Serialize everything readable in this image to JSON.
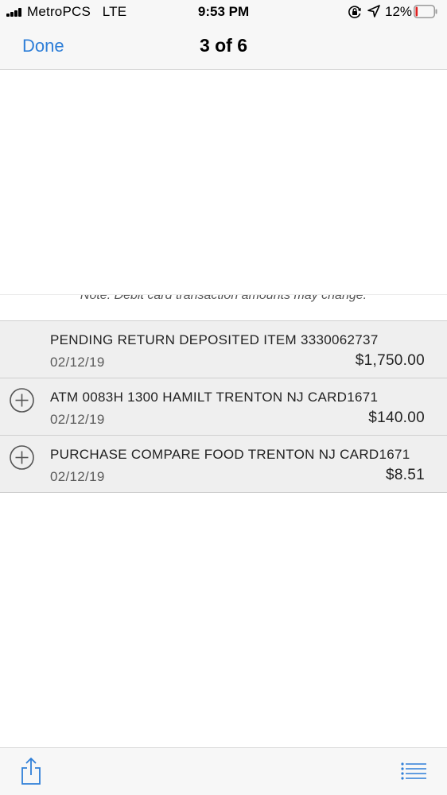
{
  "status_bar": {
    "carrier": "MetroPCS   LTE",
    "time": "9:53 PM",
    "battery_percent": "12%",
    "battery_level": 0.12,
    "battery_color": "#e02020"
  },
  "nav": {
    "done_label": "Done",
    "page_counter": "3 of 6",
    "accent_color": "#2f7fd8"
  },
  "statement": {
    "note": "Note: Debit card transaction amounts may change.",
    "transactions": [
      {
        "description": "PENDING RETURN DEPOSITED ITEM 3330062737",
        "date": "02/12/19",
        "amount": "$1,750.00"
      },
      {
        "description": "ATM 0083H 1300 HAMILT TRENTON NJ CARD1671",
        "date": "02/12/19",
        "amount": "$140.00"
      },
      {
        "description": "PURCHASE COMPARE FOOD TRENTON NJ CARD1671",
        "date": "02/12/19",
        "amount": "$8.51"
      }
    ]
  },
  "toolbar": {
    "left_icon": "share-icon",
    "right_icon": "list-icon"
  }
}
